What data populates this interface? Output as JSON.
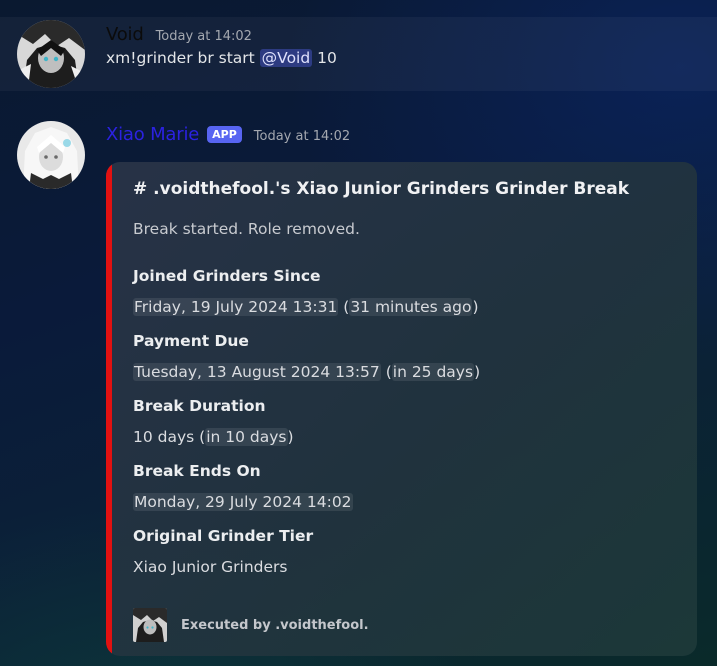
{
  "messages": [
    {
      "author": "Void",
      "timestamp": "Today at 14:02",
      "avatar_icon": "void-avatar",
      "content": {
        "text_before": "xm!grinder br start ",
        "mention": "@Void",
        "text_after": " 10"
      }
    },
    {
      "author": "Xiao Marie",
      "badge": "APP",
      "timestamp": "Today at 14:02",
      "avatar_icon": "xiao-marie-avatar",
      "embed": {
        "accent_color": "#e21111",
        "title": "# .voidthefool.'s Xiao Junior Grinders Grinder Break",
        "description": "Break started. Role removed.",
        "fields": [
          {
            "name": "Joined Grinders Since",
            "value_timestamp": "Friday, 19 July 2024 13:31",
            "value_relative_prefix": " (",
            "value_relative": "31 minutes ago",
            "value_suffix": ")"
          },
          {
            "name": "Payment Due",
            "value_timestamp": "Tuesday, 13 August 2024 13:57",
            "value_relative_prefix": " (",
            "value_relative": "in 25 days",
            "value_suffix": ")"
          },
          {
            "name": "Break Duration",
            "value_text": "10 days (",
            "value_relative": "in 10 days",
            "value_suffix": ")"
          },
          {
            "name": "Break Ends On",
            "value_timestamp": "Monday, 29 July 2024 14:02"
          },
          {
            "name": "Original Grinder Tier",
            "value": "Xiao Junior Grinders"
          }
        ],
        "footer": {
          "icon": "void-avatar",
          "text": "Executed by .voidthefool."
        }
      }
    }
  ],
  "colors": {
    "mention_bg": "#5865f2",
    "badge_bg": "#5865f2",
    "embed_accent": "#e21111",
    "author_xiao": "#2b22e0",
    "author_void": "#0b0b0b"
  }
}
